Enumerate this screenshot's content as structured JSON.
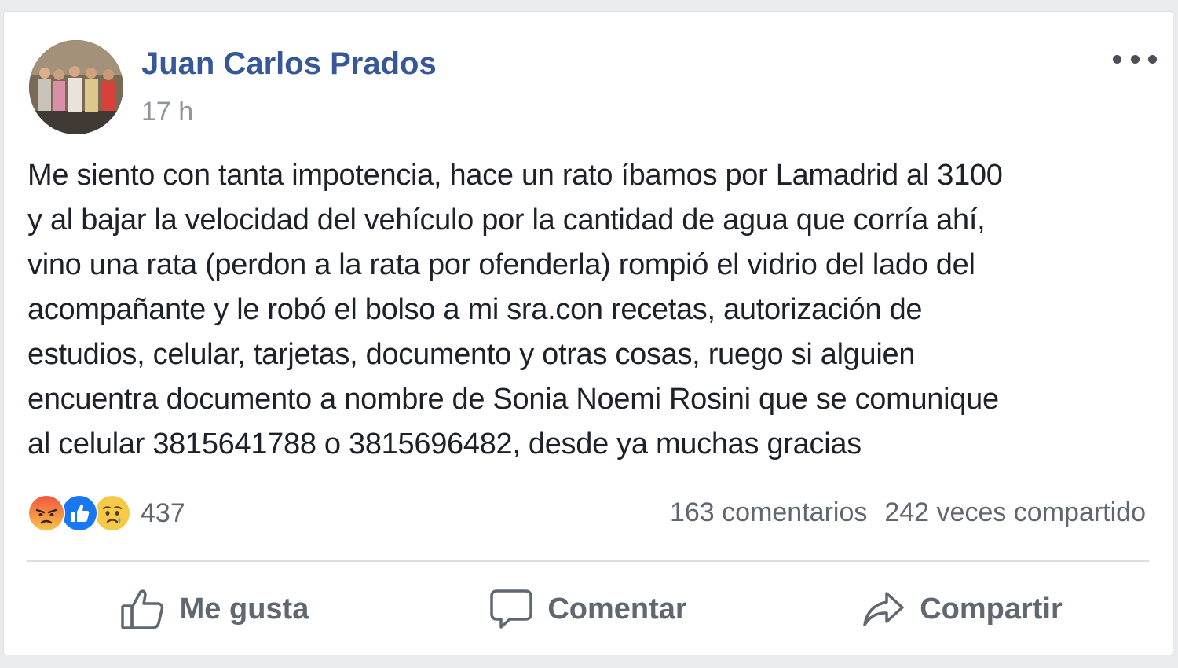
{
  "post": {
    "author": "Juan Carlos Prados",
    "time": "17 h",
    "text_lines": [
      "Me siento con tanta impotencia, hace un rato íbamos por Lamadrid al 3100",
      "y al bajar la velocidad del vehículo por la cantidad de agua que corría ahí,",
      "vino una rata (perdon a la rata por ofenderla) rompió el vidrio del lado del",
      "acompañante y le robó el bolso a mi sra.con recetas, autorización de",
      "estudios, celular, tarjetas, documento y otras cosas, ruego si alguien",
      "encuentra documento a nombre de Sonia Noemi Rosini que se comunique",
      "al celular 3815641788 o 3815696482, desde ya muchas gracias"
    ]
  },
  "reactions": {
    "icons": [
      "angry-icon",
      "like-icon",
      "sad-icon"
    ],
    "count": "437"
  },
  "stats": {
    "comments": "163 comentarios",
    "shares": "242 veces compartido"
  },
  "actions": {
    "like": "Me gusta",
    "comment": "Comentar",
    "share": "Compartir"
  },
  "colors": {
    "author": "#365899",
    "muted": "#90949c",
    "text": "#1d2129",
    "like_blue": "#1877f2",
    "angry": "#f5a623",
    "sad": "#f7c948"
  }
}
